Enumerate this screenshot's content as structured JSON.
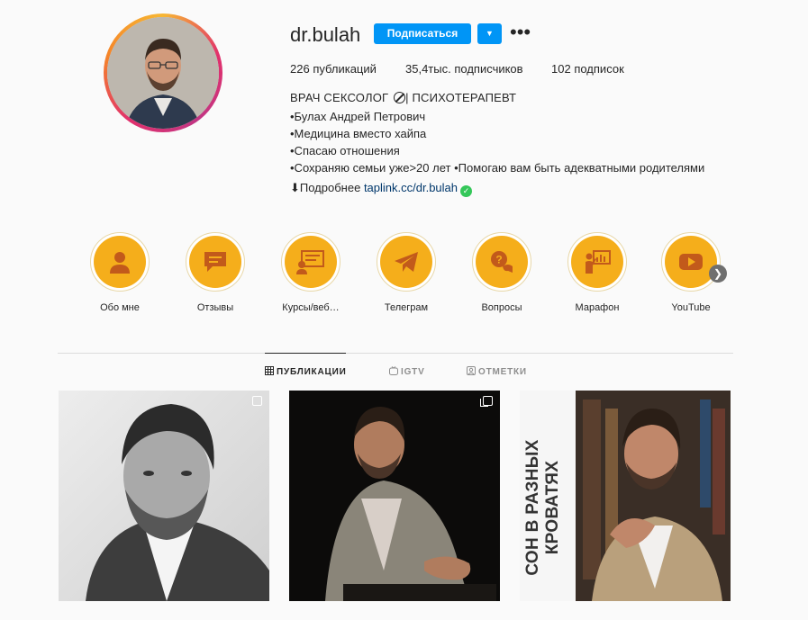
{
  "profile": {
    "username": "dr.bulah",
    "follow_label": "Подписаться",
    "dropdown_icon": "chevron-down-icon",
    "more_icon": "more-horizontal-icon"
  },
  "stats": {
    "posts": "226",
    "posts_label": "публикаций",
    "followers": "35,4тыс.",
    "followers_label": "подписчиков",
    "following": "102",
    "following_label": "подписок"
  },
  "bio": {
    "title_part1": "ВРАЧ СЕКСОЛОГ",
    "title_part2": "| ПСИХОТЕРАПЕВТ",
    "lines": [
      "•Булах Андрей Петрович",
      "•Медицина вместо хайпа",
      "•Спасаю отношения",
      "•Сохраняю семьи уже>20 лет •Помогаю вам быть адекватными родителями"
    ],
    "more_prefix": "⬇Подробнее",
    "link": "taplink.cc/dr.bulah"
  },
  "highlights": [
    {
      "label": "Обо мне",
      "icon": "person-icon"
    },
    {
      "label": "Отзывы",
      "icon": "chat-icon"
    },
    {
      "label": "Курсы/веб…",
      "icon": "webinar-icon"
    },
    {
      "label": "Телеграм",
      "icon": "telegram-icon"
    },
    {
      "label": "Вопросы",
      "icon": "question-icon"
    },
    {
      "label": "Марафон",
      "icon": "presentation-icon"
    },
    {
      "label": "YouTube",
      "icon": "youtube-icon"
    }
  ],
  "tabs": [
    {
      "label": "ПУБЛИКАЦИИ",
      "icon": "grid-icon",
      "active": true
    },
    {
      "label": "IGTV",
      "icon": "igtv-icon",
      "active": false
    },
    {
      "label": "ОТМЕТКИ",
      "icon": "tag-icon",
      "active": false
    }
  ],
  "posts": [
    {
      "type": "photo",
      "badge": "carousel-icon"
    },
    {
      "type": "photo",
      "badge": "carousel-icon"
    },
    {
      "type": "text-photo",
      "caption": "СОН В РАЗНЫХ КРОВАТЯХ"
    }
  ],
  "colors": {
    "accent": "#0095f6",
    "highlight": "#f5ae1b"
  }
}
